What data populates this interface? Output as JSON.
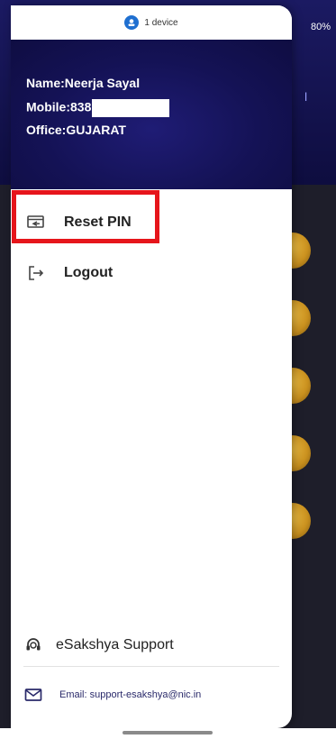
{
  "status": {
    "device_count": "1 device",
    "battery": "80%"
  },
  "background": {
    "partial_letter": "l"
  },
  "user": {
    "name_label": "Name:",
    "name_value": "Neerja Sayal",
    "mobile_label": "Mobile:",
    "mobile_value": "838",
    "office_label": "Office:",
    "office_value": "GUJARAT"
  },
  "menu": {
    "items": [
      {
        "label": "Reset PIN",
        "icon": "reset-pin-icon"
      },
      {
        "label": "Logout",
        "icon": "logout-icon"
      }
    ]
  },
  "footer": {
    "support_label": "eSakshya Support",
    "email_text": "Email: support-esakshya@nic.in"
  },
  "colors": {
    "header_bg": "#141255",
    "highlight": "#e6151b",
    "accent_blue": "#1f6fd0"
  }
}
